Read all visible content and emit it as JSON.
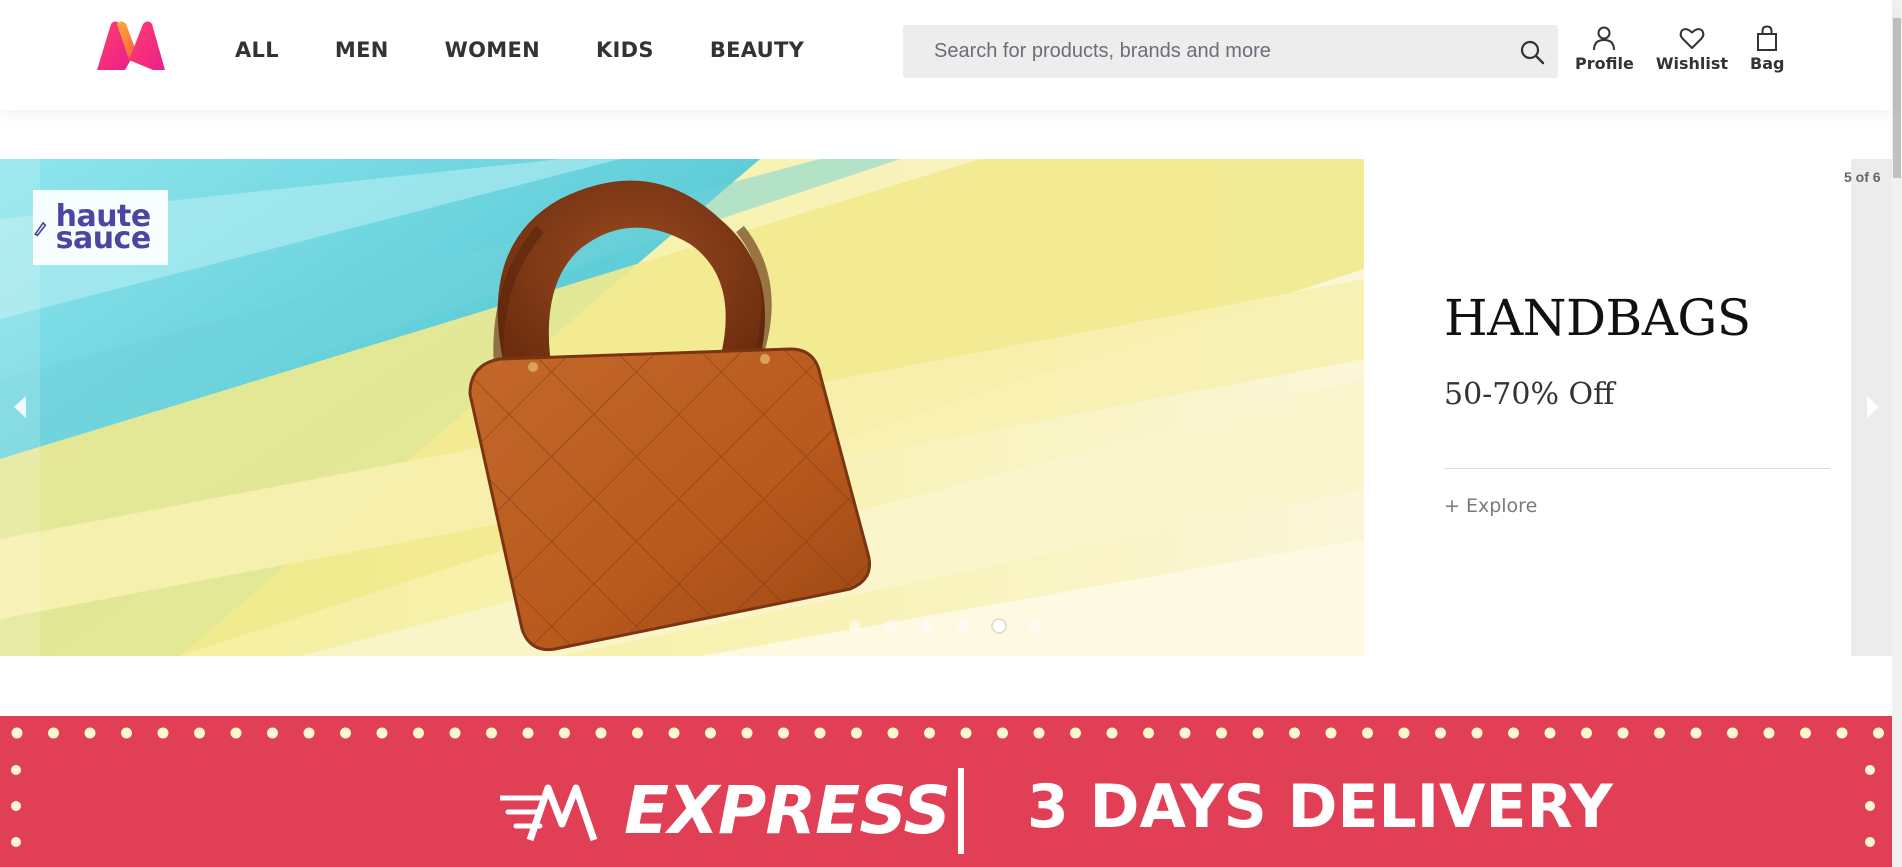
{
  "header": {
    "logo_icon": "myntra-logo-icon",
    "nav": [
      "ALL",
      "MEN",
      "WOMEN",
      "KIDS",
      "BEAUTY"
    ],
    "search": {
      "placeholder": "Search for products, brands and more",
      "icon": "search-icon"
    },
    "actions": [
      {
        "label": "Profile",
        "icon": "user-icon"
      },
      {
        "label": "Wishlist",
        "icon": "heart-icon"
      },
      {
        "label": "Bag",
        "icon": "bag-icon"
      }
    ]
  },
  "carousel": {
    "brand": "haute sauce",
    "counter": "5 of 6",
    "slides_total": 6,
    "active_index": 4,
    "title": "HANDBAGS",
    "subtitle": "50-70% Off",
    "cta": "+ Explore"
  },
  "express_banner": {
    "label": "EXPRESS",
    "delivery": "3 DAYS DELIVERY"
  },
  "colors": {
    "accent": "#e13f56",
    "brand_pink": "#ff3f6c",
    "brand_orange": "#f68b1e"
  }
}
